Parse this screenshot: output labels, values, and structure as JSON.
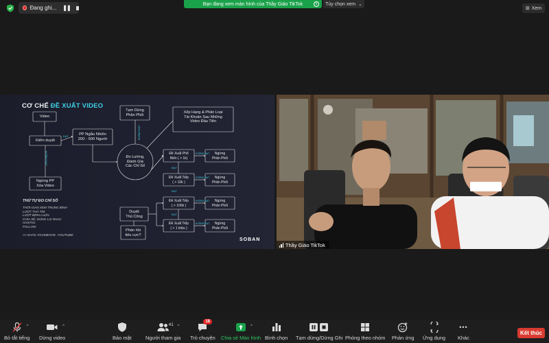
{
  "topbar": {
    "recording_label": "Đang ghi...",
    "pause_symbol": "❚❚",
    "share_banner": "Bạn đang xem màn hình của Thầy Giáo TikTok",
    "share_info_symbol": "i",
    "view_options": "Tùy chọn xem",
    "view_options_caret": "⌄",
    "view_button": "Xem",
    "view_button_symbol": "⊞"
  },
  "slide": {
    "title_prefix": "CƠ CHẾ",
    "title_highlight": "ĐỀ XUẤT VIDEO",
    "nodes": {
      "video": "Video",
      "kiem_duyet": "Kiểm duyệt",
      "ngung_pp_line1": "Ngừng PP",
      "ngung_pp_line2": "Xóa Video",
      "pp_ngau_nhien_line1": "PP Ngẫu Nhiên",
      "pp_ngau_nhien_line2": "200 - 500 Người",
      "tam_dung_line1": "Tạm Dừng",
      "tam_dung_line2": "Phân Phối",
      "xep_hang_line1": "Xếp Hạng & Phân Loại",
      "xep_hang_line2": "Tài Khoản Sau Những",
      "xep_hang_line3": "Video Đầu Tiên",
      "do_luong_line1": "Đo Lường,",
      "do_luong_line2": "Đánh Giá",
      "do_luong_line3": "Các Chỉ Số",
      "de_xuat_1_line1": "Đề Xuất Phổ",
      "de_xuat_1_line2": "Biến ( > 1k)",
      "de_xuat_2_line1": "Đề Xuất Tiếp",
      "de_xuat_2_line2": "( > 10k )",
      "de_xuat_3_line1": "Đề Xuất Tiếp",
      "de_xuat_3_line2": "( > 100k )",
      "de_xuat_4_line1": "Đề Xuất Tiếp",
      "de_xuat_4_line2": "( > 1 triệu )",
      "ngung_1_line1": "Ngừng",
      "ngung_1_line2": "Phân Phối",
      "ngung_2_line1": "Ngừng",
      "ngung_2_line2": "Phân Phối",
      "ngung_3_line1": "Ngừng",
      "ngung_3_line2": "Phân Phối",
      "ngung_4_line1": "Ngừng",
      "ngung_4_line2": "Phân Phối",
      "duyet_line1": "Duyệt",
      "duyet_line2": "Thủ Công",
      "phan_hoi_line1": "Phản hồi",
      "phan_hoi_line2": "tiêu cực?"
    },
    "edge_labels": {
      "dat": "ĐẠT",
      "khong_dat": "KHÔNG ĐẠT"
    },
    "order_title": "THỨ TỰ ĐO CHỈ SỐ",
    "order_items": [
      "THỜI GIAN XEM TRUNG BÌNH",
      "LƯỢT THẢ TIM",
      "LƯỢT BÌNH LUẬN",
      "CHIA SẺ, DÙNG LẠI NHẠC",
      "HASTAG",
      "FOLLOW"
    ],
    "order_more": ">> KHÁC FACEBOOK, YOUTUBE",
    "brand": "SOBAN"
  },
  "video": {
    "participant_name": "Thầy Giáo TikTok"
  },
  "toolbar": {
    "items": [
      {
        "label": "Bỏ tắt tiếng",
        "icon": "muted-microphone-icon"
      },
      {
        "label": "Dừng video",
        "icon": "video-camera-icon"
      },
      {
        "label": "Bảo mật",
        "icon": "security-shield-icon"
      },
      {
        "label": "Người tham gia",
        "icon": "participants-icon"
      },
      {
        "label": "Trò chuyện",
        "icon": "chat-icon"
      },
      {
        "label": "Chia sẻ Màn hình",
        "icon": "share-screen-icon"
      },
      {
        "label": "Bình chọn",
        "icon": "polls-icon"
      },
      {
        "label": "Tạm dừng/Dừng Ghi",
        "icon": "pause-stop-recording-icon"
      },
      {
        "label": "Phòng theo nhóm",
        "icon": "breakout-rooms-icon"
      },
      {
        "label": "Phản ứng",
        "icon": "reactions-icon"
      },
      {
        "label": "Ứng dụng",
        "icon": "apps-icon"
      },
      {
        "label": "Khác",
        "icon": "more-icon"
      }
    ],
    "participants_count": "41",
    "chat_badge": "18",
    "caret": "^",
    "more_symbol": "•••",
    "end_button": "Kết thúc",
    "colors": {
      "share_green": "#1aa24a",
      "end_red": "#d93b30",
      "badge_red": "#e02828",
      "accent_cyan": "#3fd0e4"
    }
  }
}
